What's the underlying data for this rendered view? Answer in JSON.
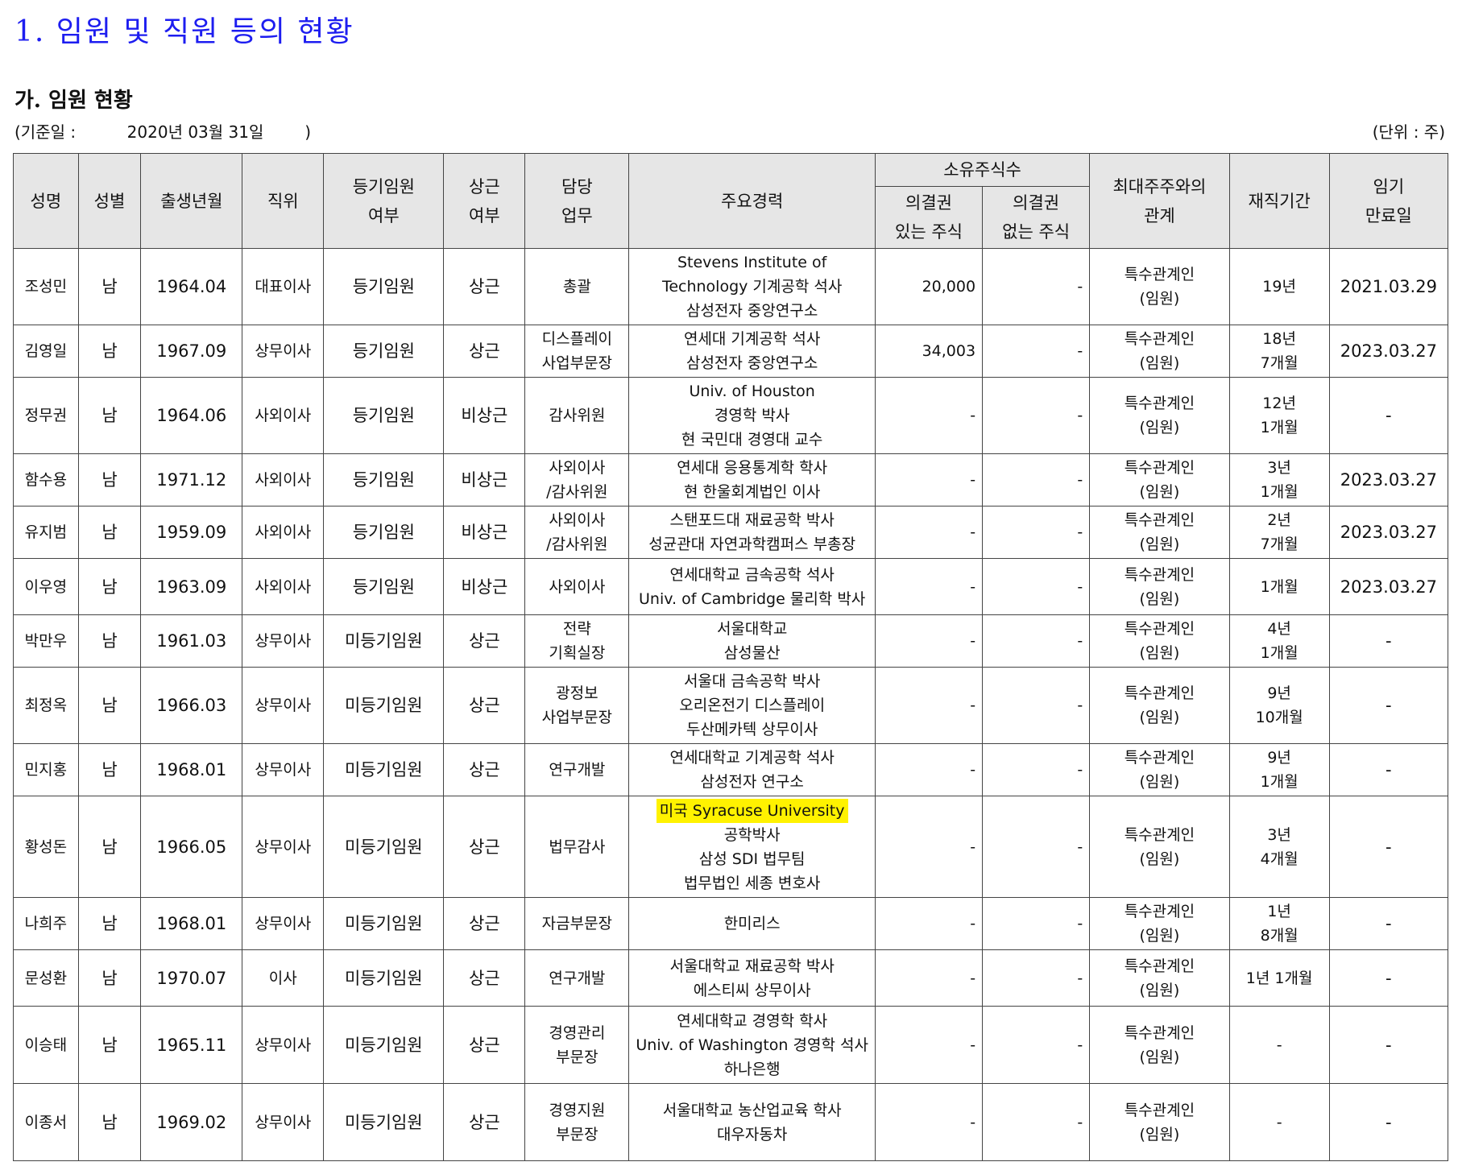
{
  "page": {
    "title": "1. 임원 및 직원 등의 현황",
    "subtitle": "가. 임원 현황",
    "base_date": "(기준일 :          2020년 03월 31일        )",
    "unit": "(단위 : 주)"
  },
  "table": {
    "headers": {
      "name": "성명",
      "gender": "성별",
      "birth": "출생년월",
      "position": "직위",
      "registered": [
        "등기임원",
        "여부"
      ],
      "fulltime": [
        "상근",
        "여부"
      ],
      "duty": [
        "담당",
        "업무"
      ],
      "career": "주요경력",
      "shares_group": "소유주식수",
      "voting": [
        "의결권",
        "있는 주식"
      ],
      "nonvoting": [
        "의결권",
        "없는 주식"
      ],
      "relation": [
        "최대주주와의",
        "관계"
      ],
      "tenure": "재직기간",
      "term_end": [
        "임기",
        "만료일"
      ]
    },
    "rows": [
      {
        "name": "조성민",
        "gender": "남",
        "birth": "1964.04",
        "position": "대표이사",
        "registered": "등기임원",
        "fulltime": "상근",
        "duty": [
          "총괄"
        ],
        "career": [
          "Stevens Institute of",
          "Technology 기계공학 석사",
          "삼성전자 중앙연구소"
        ],
        "voting": "20,000",
        "nonvoting": "-",
        "relation": [
          "특수관계인",
          "(임원)"
        ],
        "tenure": [
          "19년"
        ],
        "term_end": "2021.03.29"
      },
      {
        "name": "김영일",
        "gender": "남",
        "birth": "1967.09",
        "position": "상무이사",
        "registered": "등기임원",
        "fulltime": "상근",
        "duty": [
          "디스플레이",
          "사업부문장"
        ],
        "career": [
          "연세대 기계공학 석사",
          "삼성전자 중앙연구소"
        ],
        "voting": "34,003",
        "nonvoting": "-",
        "relation": [
          "특수관계인",
          "(임원)"
        ],
        "tenure": [
          "18년",
          "7개월"
        ],
        "term_end": "2023.03.27"
      },
      {
        "name": "정무권",
        "gender": "남",
        "birth": "1964.06",
        "position": "사외이사",
        "registered": "등기임원",
        "fulltime": "비상근",
        "duty": [
          "감사위원"
        ],
        "career": [
          "Univ. of Houston",
          "경영학 박사",
          "현 국민대 경영대 교수"
        ],
        "voting": "-",
        "nonvoting": "-",
        "relation": [
          "특수관계인",
          "(임원)"
        ],
        "tenure": [
          "12년",
          "1개월"
        ],
        "term_end": "-"
      },
      {
        "name": "함수용",
        "gender": "남",
        "birth": "1971.12",
        "position": "사외이사",
        "registered": "등기임원",
        "fulltime": "비상근",
        "duty": [
          "사외이사",
          "/감사위원"
        ],
        "career": [
          "연세대 응용통계학 학사",
          "현 한울회계법인 이사"
        ],
        "voting": "-",
        "nonvoting": "-",
        "relation": [
          "특수관계인",
          "(임원)"
        ],
        "tenure": [
          "3년",
          "1개월"
        ],
        "term_end": "2023.03.27"
      },
      {
        "name": "유지범",
        "gender": "남",
        "birth": "1959.09",
        "position": "사외이사",
        "registered": "등기임원",
        "fulltime": "비상근",
        "duty": [
          "사외이사",
          "/감사위원"
        ],
        "career": [
          "스탠포드대 재료공학 박사",
          "성균관대 자연과학캠퍼스 부총장"
        ],
        "voting": "-",
        "nonvoting": "-",
        "relation": [
          "특수관계인",
          "(임원)"
        ],
        "tenure": [
          "2년",
          "7개월"
        ],
        "term_end": "2023.03.27"
      },
      {
        "name": "이우영",
        "gender": "남",
        "birth": "1963.09",
        "position": "사외이사",
        "registered": "등기임원",
        "fulltime": "비상근",
        "duty": [
          "사외이사"
        ],
        "career": [
          "연세대학교 금속공학 석사",
          "Univ. of Cambridge 물리학 박사"
        ],
        "voting": "-",
        "nonvoting": "-",
        "relation": [
          "특수관계인",
          "(임원)"
        ],
        "tenure": [
          "1개월"
        ],
        "term_end": "2023.03.27"
      },
      {
        "name": "박만우",
        "gender": "남",
        "birth": "1961.03",
        "position": "상무이사",
        "registered": "미등기임원",
        "fulltime": "상근",
        "duty": [
          "전략",
          "기획실장"
        ],
        "career": [
          "서울대학교",
          "삼성물산"
        ],
        "voting": "-",
        "nonvoting": "-",
        "relation": [
          "특수관계인",
          "(임원)"
        ],
        "tenure": [
          "4년",
          "1개월"
        ],
        "term_end": "-"
      },
      {
        "name": "최정옥",
        "gender": "남",
        "birth": "1966.03",
        "position": "상무이사",
        "registered": "미등기임원",
        "fulltime": "상근",
        "duty": [
          "광정보",
          "사업부문장"
        ],
        "career": [
          "서울대 금속공학 박사",
          "오리온전기 디스플레이",
          "두산메카텍 상무이사"
        ],
        "voting": "-",
        "nonvoting": "-",
        "relation": [
          "특수관계인",
          "(임원)"
        ],
        "tenure": [
          "9년",
          "10개월"
        ],
        "term_end": "-"
      },
      {
        "name": "민지홍",
        "gender": "남",
        "birth": "1968.01",
        "position": "상무이사",
        "registered": "미등기임원",
        "fulltime": "상근",
        "duty": [
          "연구개발"
        ],
        "career": [
          "연세대학교 기계공학 석사",
          "삼성전자 연구소"
        ],
        "voting": "-",
        "nonvoting": "-",
        "relation": [
          "특수관계인",
          "(임원)"
        ],
        "tenure": [
          "9년",
          "1개월"
        ],
        "term_end": "-"
      },
      {
        "name": "황성돈",
        "gender": "남",
        "birth": "1966.05",
        "position": "상무이사",
        "registered": "미등기임원",
        "fulltime": "상근",
        "duty": [
          "법무감사"
        ],
        "career": [
          "미국 Syracuse University",
          "공학박사",
          "삼성 SDI 법무팀",
          "법무법인 세종 변호사"
        ],
        "voting": "-",
        "nonvoting": "-",
        "relation": [
          "특수관계인",
          "(임원)"
        ],
        "tenure": [
          "3년",
          "4개월"
        ],
        "term_end": "-"
      },
      {
        "name": "나희주",
        "gender": "남",
        "birth": "1968.01",
        "position": "상무이사",
        "registered": "미등기임원",
        "fulltime": "상근",
        "duty": [
          "자금부문장"
        ],
        "career": [
          "한미리스"
        ],
        "voting": "-",
        "nonvoting": "-",
        "relation": [
          "특수관계인",
          "(임원)"
        ],
        "tenure": [
          "1년",
          "8개월"
        ],
        "term_end": "-"
      },
      {
        "name": "문성환",
        "gender": "남",
        "birth": "1970.07",
        "position": "이사",
        "registered": "미등기임원",
        "fulltime": "상근",
        "duty": [
          "연구개발"
        ],
        "career": [
          "서울대학교 재료공학 박사",
          "에스티씨 상무이사"
        ],
        "voting": "-",
        "nonvoting": "-",
        "relation": [
          "특수관계인",
          "(임원)"
        ],
        "tenure": [
          "1년 1개월"
        ],
        "term_end": "-"
      },
      {
        "name": "이승태",
        "gender": "남",
        "birth": "1965.11",
        "position": "상무이사",
        "registered": "미등기임원",
        "fulltime": "상근",
        "duty": [
          "경영관리",
          "부문장"
        ],
        "career": [
          "연세대학교 경영학 학사",
          "Univ. of Washington 경영학 석사",
          "하나은행"
        ],
        "voting": "-",
        "nonvoting": "-",
        "relation": [
          "특수관계인",
          "(임원)"
        ],
        "tenure": [
          "-"
        ],
        "term_end": "-"
      },
      {
        "name": "이종서",
        "gender": "남",
        "birth": "1969.02",
        "position": "상무이사",
        "registered": "미등기임원",
        "fulltime": "상근",
        "duty": [
          "경영지원",
          "부문장"
        ],
        "career": [
          "서울대학교 농산업교육 학사",
          "대우자동차"
        ],
        "voting": "-",
        "nonvoting": "-",
        "relation": [
          "특수관계인",
          "(임원)"
        ],
        "tenure": [
          "-"
        ],
        "term_end": "-"
      }
    ],
    "highlight_color": "#fff200"
  }
}
